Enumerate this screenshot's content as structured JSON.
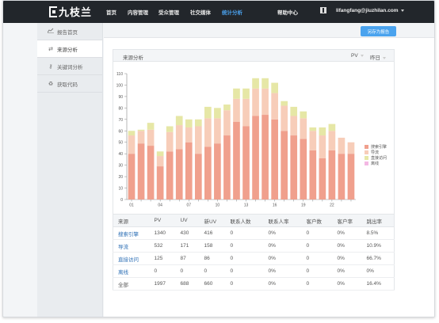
{
  "brand": {
    "name": "九枝兰"
  },
  "nav": {
    "items": [
      "首页",
      "内容管理",
      "受众管理",
      "社交媒体",
      "统计分析"
    ],
    "active_index": 4,
    "help": "帮助中心",
    "user": "lifangfang@jiuzhilan.com"
  },
  "sidebar": {
    "items": [
      {
        "label": "报告首页",
        "icon": "line-chart-icon"
      },
      {
        "label": "来源分析",
        "icon": "shuffle-icon"
      },
      {
        "label": "关键词分析",
        "icon": "key-icon"
      },
      {
        "label": "获取代码",
        "icon": "recycle-icon"
      }
    ],
    "active_index": 1
  },
  "toolbar": {
    "export_label": "另存为报告"
  },
  "panel": {
    "title": "来源分析",
    "metric_select": "PV",
    "date_select": "昨日"
  },
  "colors": {
    "search": "#f0a08d",
    "direct_nav": "#f7cdb9",
    "direct_visit": "#e6e7a6",
    "offline": "#f4b8e4",
    "accent": "#4aa3ee"
  },
  "chart_data": {
    "type": "bar",
    "stacked": true,
    "categories": [
      "01",
      "02",
      "03",
      "04",
      "05",
      "06",
      "07",
      "08",
      "09",
      "10",
      "11",
      "12",
      "13",
      "14",
      "15",
      "16",
      "17",
      "18",
      "19",
      "20",
      "21",
      "22",
      "23",
      "24"
    ],
    "x_tick_labels": [
      "01",
      "04",
      "07",
      "10",
      "13",
      "16",
      "19",
      "22"
    ],
    "ylim": [
      0,
      110
    ],
    "y_ticks": [
      0,
      10,
      20,
      30,
      40,
      50,
      60,
      70,
      80,
      90,
      100,
      110
    ],
    "legend_position": "right",
    "series": [
      {
        "name": "搜索引擎",
        "values": [
          40,
          49,
          47,
          29,
          42,
          44,
          50,
          40,
          46,
          49,
          56,
          68,
          64,
          73,
          74,
          70,
          60,
          56,
          53,
          43,
          36,
          43,
          40,
          0
        ]
      },
      {
        "name": "导流",
        "values": [
          16,
          11,
          14,
          9,
          17,
          21,
          13,
          24,
          25,
          22,
          22,
          20,
          24,
          24,
          23,
          23,
          22,
          17,
          18,
          17,
          20,
          17,
          14,
          0
        ]
      },
      {
        "name": "直接访问",
        "values": [
          4,
          1,
          6,
          4,
          5,
          8,
          7,
          6,
          10,
          9,
          5,
          9,
          9,
          9,
          9,
          9,
          4,
          8,
          6,
          3,
          7,
          6,
          0,
          0
        ]
      },
      {
        "name": "离线",
        "values": [
          0,
          0,
          0,
          0,
          0,
          0,
          0,
          0,
          0,
          0,
          0,
          0,
          0,
          0,
          0,
          0,
          0,
          0,
          0,
          0,
          0,
          0,
          0,
          0
        ]
      }
    ],
    "partial_last_bar": {
      "search": 40,
      "direct_nav": 10
    }
  },
  "table": {
    "headers": [
      "来源",
      "PV",
      "UV",
      "新UV",
      "联系人数",
      "联系人率",
      "客户数",
      "客户率",
      "跳出率"
    ],
    "rows": [
      [
        "搜索引擎",
        "1340",
        "430",
        "416",
        "0",
        "0%",
        "0",
        "0%",
        "8.5%"
      ],
      [
        "导流",
        "532",
        "171",
        "158",
        "0",
        "0%",
        "0",
        "0%",
        "10.9%"
      ],
      [
        "直接访问",
        "125",
        "87",
        "86",
        "0",
        "0%",
        "0",
        "0%",
        "66.7%"
      ],
      [
        "离线",
        "0",
        "0",
        "0",
        "0",
        "0%",
        "0",
        "0%",
        "0%"
      ],
      [
        "全部",
        "1997",
        "688",
        "660",
        "0",
        "0%",
        "0",
        "0%",
        "16.4%"
      ]
    ]
  }
}
